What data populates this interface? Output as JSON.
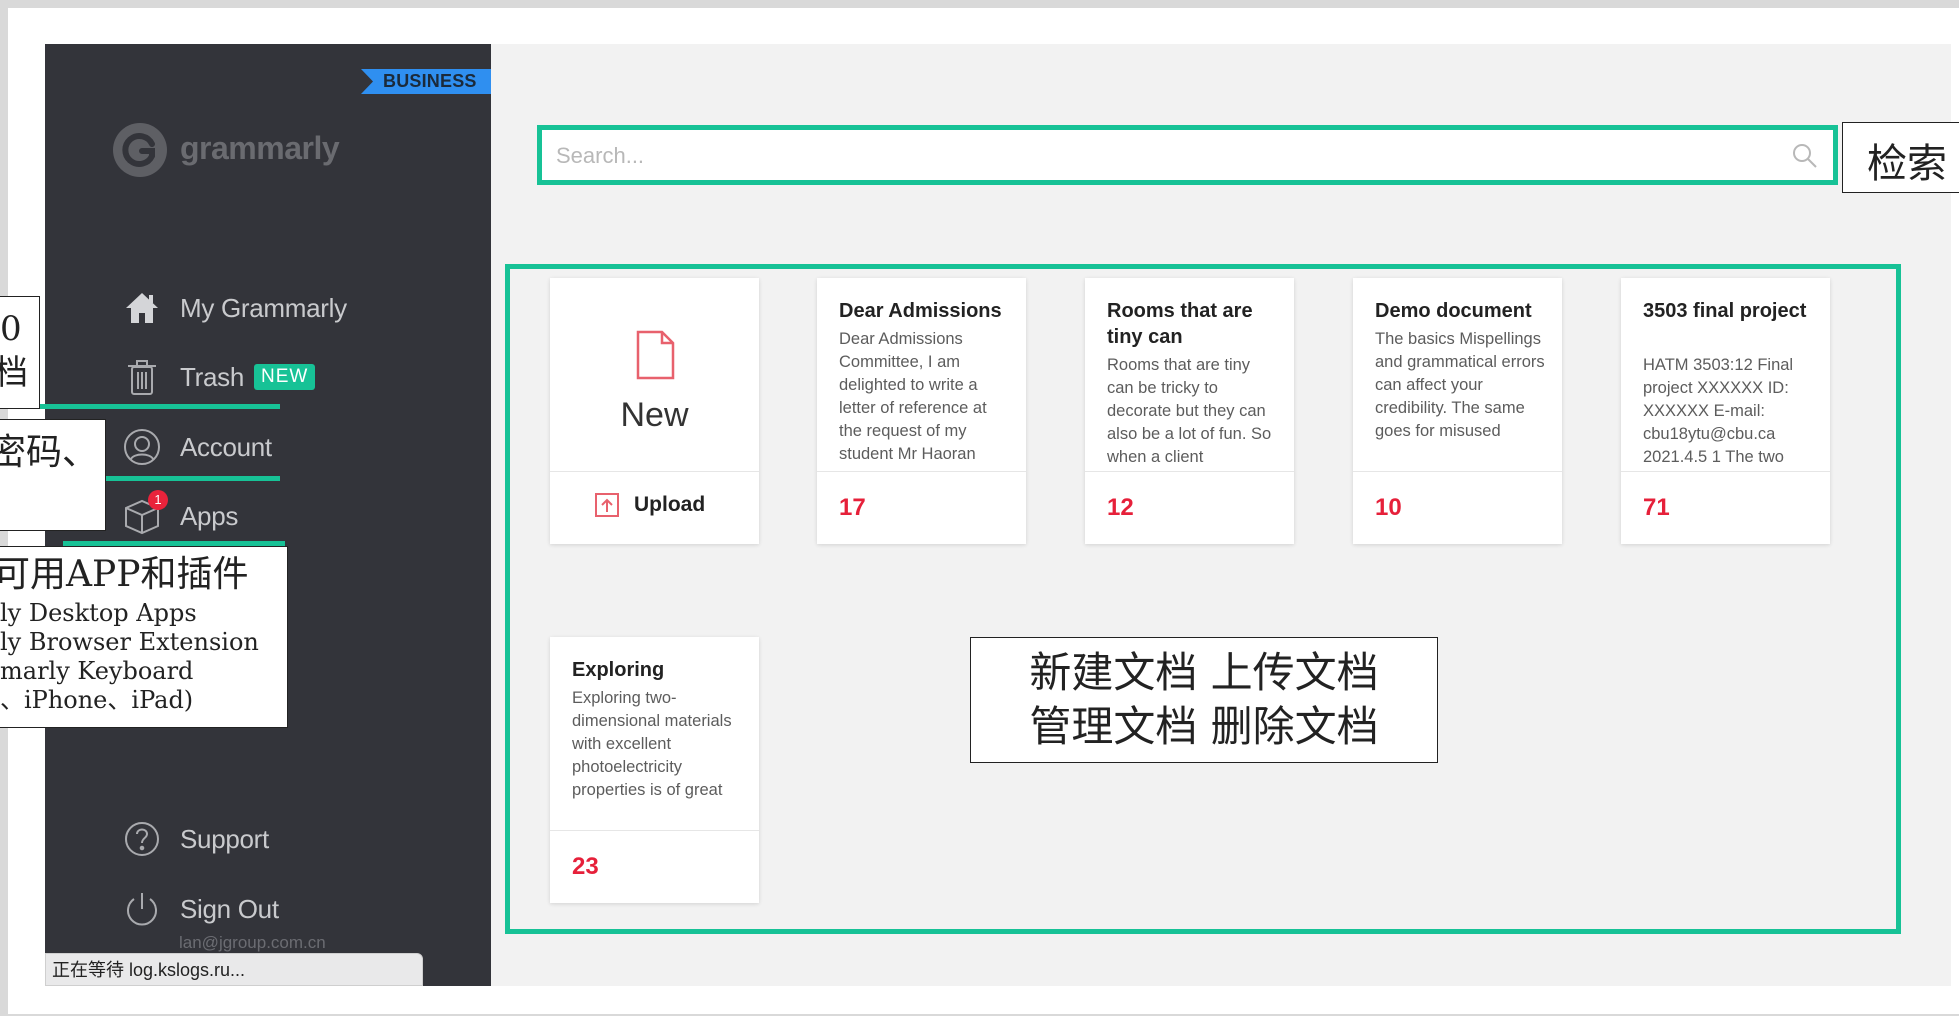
{
  "sidebar": {
    "badge": "BUSINESS",
    "logo_text": "grammarly",
    "nav": [
      {
        "label": "My Grammarly",
        "icon": "home-icon"
      },
      {
        "label": "Trash",
        "icon": "trash-icon",
        "pill": "NEW"
      },
      {
        "label": "Account",
        "icon": "account-icon"
      },
      {
        "label": "Apps",
        "icon": "apps-box-icon",
        "badge_count": "1"
      },
      {
        "label": "Support",
        "icon": "help-circle-icon"
      },
      {
        "label": "Sign Out",
        "icon": "power-icon"
      }
    ],
    "email": "lan@jgroup.com.cn"
  },
  "status_bar": "正在等待 log.kslogs.ru...",
  "search": {
    "placeholder": "Search..."
  },
  "new_card": {
    "label": "New",
    "upload": "Upload"
  },
  "documents": [
    {
      "title": "Dear Admissions",
      "snippet": "Dear Admissions Committee, I am delighted to write a letter of reference at the request of my student Mr Haoran",
      "count": "17"
    },
    {
      "title": "Rooms that are tiny can",
      "snippet": "Rooms that are tiny can be tricky to decorate but they can also be a lot of fun. So when a client",
      "count": "12"
    },
    {
      "title": "Demo document",
      "snippet": "The basics Mispellings and grammatical errors can affect your credibility. The same goes for misused",
      "count": "10"
    },
    {
      "title": "3503 final project",
      "snippet": "HATM 3503:12 Final project XXXXXX ID: XXXXXX E-mail: cbu18ytu@cbu.ca 2021.4.5 1 The two",
      "count": "71"
    },
    {
      "title": "Exploring",
      "snippet": "Exploring two-dimensional materials with excellent photoelectricity properties is of great",
      "count": "23"
    }
  ],
  "callouts": {
    "search": "检索",
    "docs": [
      "新建文档 上传文档",
      "管理文档 删除文档"
    ],
    "trash": [
      "0",
      "档"
    ],
    "account": [
      "密码、",
      ""
    ],
    "apps": [
      "可用APP和插件",
      "ly Desktop Apps",
      "ly Browser Extension",
      "marly Keyboard",
      "、iPhone、iPad)"
    ]
  },
  "colors": {
    "accent": "#17c296",
    "sidebar": "#33343a",
    "count": "#e6203a"
  }
}
